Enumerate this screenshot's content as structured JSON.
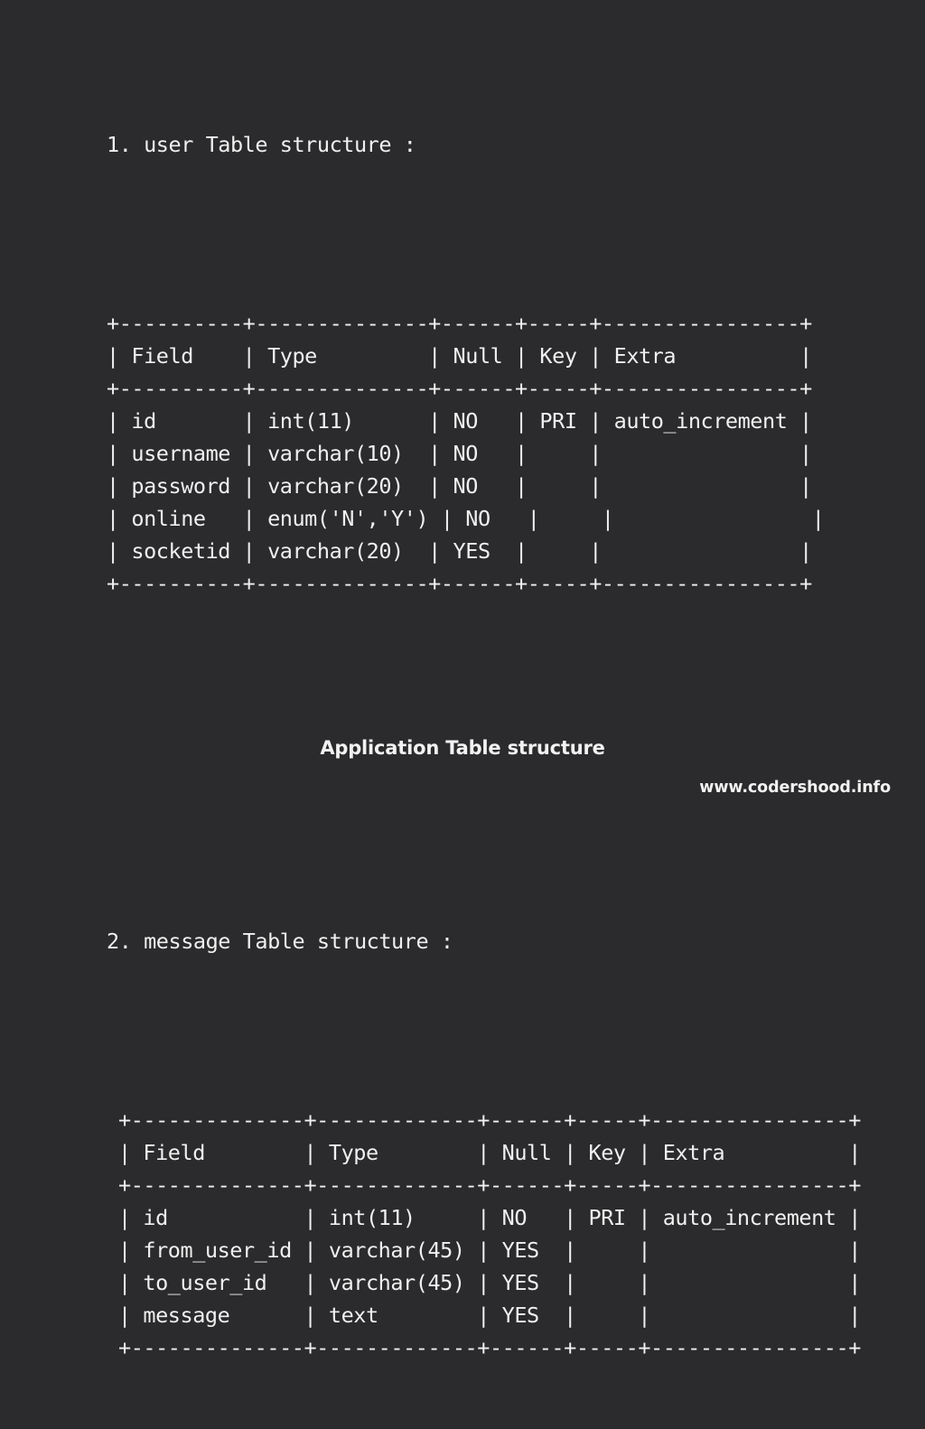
{
  "background_color": "#2b2a2c",
  "text_color": "#f0f0f0",
  "sections": [
    {
      "heading": "1. user Table structure :",
      "table_name": "user",
      "index_label": "1.",
      "ascii": "+----------+--------------+------+-----+----------------+\n| Field    | Type         | Null | Key | Extra          |\n+----------+--------------+------+-----+----------------+\n| id       | int(11)      | NO   | PRI | auto_increment |\n| username | varchar(10)  | NO   |     |                |\n| password | varchar(20)  | NO   |     |                |\n| online   | enum('N','Y') | NO   |     |                |\n| socketid | varchar(20)  | YES  |     |                |\n+----------+--------------+------+-----+----------------+"
    },
    {
      "heading": "2. message Table structure :",
      "table_name": "message",
      "index_label": "2.",
      "ascii": "+--------------+-------------+------+-----+----------------+\n| Field        | Type        | Null | Key | Extra          |\n+--------------+-------------+------+-----+----------------+\n| id           | int(11)     | NO   | PRI | auto_increment |\n| from_user_id | varchar(45) | YES  |     |                |\n| to_user_id   | varchar(45) | YES  |     |                |\n| message      | text        | YES  |     |                |\n+--------------+-------------+------+-----+----------------+"
    }
  ],
  "table_user": {
    "columns": [
      "Field",
      "Type",
      "Null",
      "Key",
      "Extra"
    ],
    "rows": [
      [
        "id",
        "int(11)",
        "NO",
        "PRI",
        "auto_increment"
      ],
      [
        "username",
        "varchar(10)",
        "NO",
        "",
        ""
      ],
      [
        "password",
        "varchar(20)",
        "NO",
        "",
        ""
      ],
      [
        "online",
        "enum('N','Y')",
        "NO",
        "",
        ""
      ],
      [
        "socketid",
        "varchar(20)",
        "YES",
        "",
        ""
      ]
    ]
  },
  "table_message": {
    "columns": [
      "Field",
      "Type",
      "Null",
      "Key",
      "Extra"
    ],
    "rows": [
      [
        "id",
        "int(11)",
        "NO",
        "PRI",
        "auto_increment"
      ],
      [
        "from_user_id",
        "varchar(45)",
        "YES",
        "",
        ""
      ],
      [
        "to_user_id",
        "varchar(45)",
        "YES",
        "",
        ""
      ],
      [
        "message",
        "text",
        "YES",
        "",
        ""
      ]
    ]
  },
  "caption": "Application Table structure",
  "footer": "www.codershood.info"
}
